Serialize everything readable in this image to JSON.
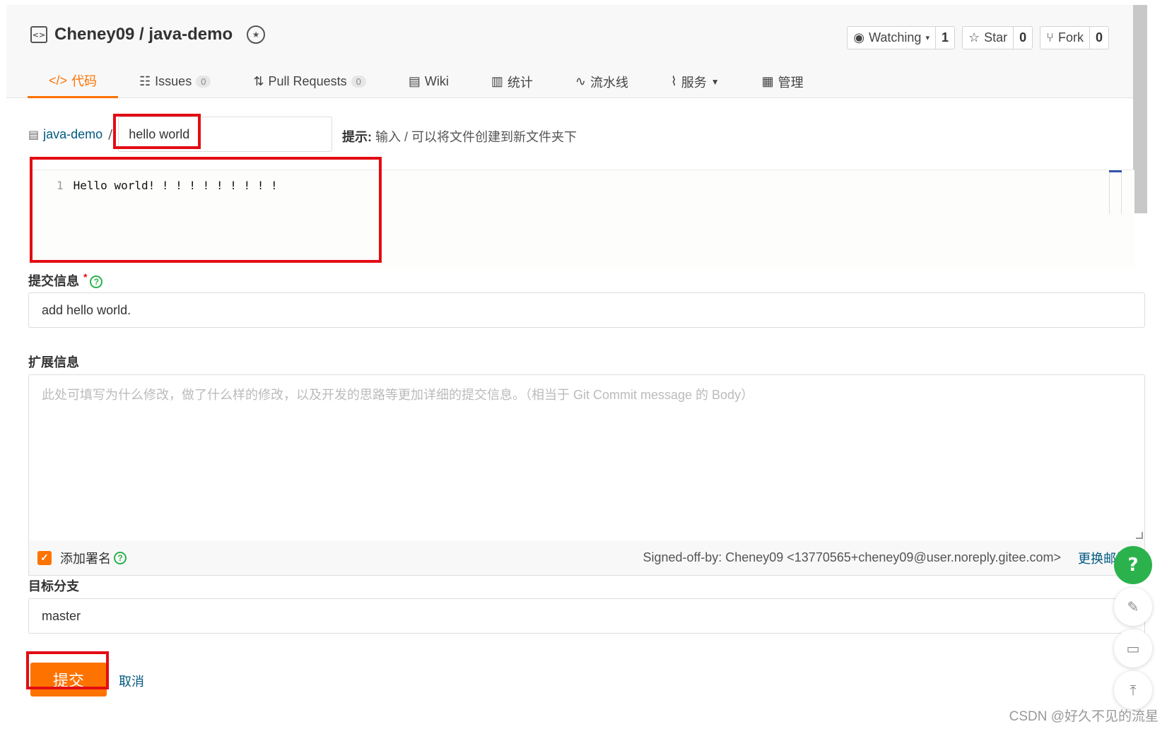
{
  "repo": {
    "title": "Cheney09 / java-demo",
    "icon": "code-repo-icon",
    "badge_icon": "gvp-badge-icon"
  },
  "actions": {
    "watch": {
      "label": "Watching",
      "icon": "eye-icon",
      "count": "1"
    },
    "star": {
      "label": "Star",
      "icon": "star-icon",
      "count": "0"
    },
    "fork": {
      "label": "Fork",
      "icon": "fork-icon",
      "count": "0"
    }
  },
  "tabs": [
    {
      "label": "代码",
      "icon": "code-icon",
      "active": true
    },
    {
      "label": "Issues",
      "icon": "issues-icon",
      "count": "0"
    },
    {
      "label": "Pull Requests",
      "icon": "pull-request-icon",
      "count": "0"
    },
    {
      "label": "Wiki",
      "icon": "wiki-icon"
    },
    {
      "label": "统计",
      "icon": "stats-icon"
    },
    {
      "label": "流水线",
      "icon": "pipeline-icon"
    },
    {
      "label": "服务",
      "icon": "service-icon"
    },
    {
      "label": "管理",
      "icon": "manage-icon"
    }
  ],
  "breadcrumb": {
    "root": "java-demo",
    "separator": "/"
  },
  "filename": {
    "value": "hello world"
  },
  "hint": {
    "label": "提示:",
    "text": "输入 / 可以将文件创建到新文件夹下"
  },
  "editor": {
    "line_number": "1",
    "line": "Hello world! ! ! ! ! ! ! ! ! !"
  },
  "commit": {
    "label": "提交信息",
    "required": "*",
    "value": "add hello world."
  },
  "extended": {
    "label": "扩展信息",
    "placeholder": "此处可填写为什么修改，做了什么样的修改，以及开发的思路等更加详细的提交信息。（相当于 Git Commit message 的 Body）"
  },
  "signoff": {
    "checkbox_label": "添加署名",
    "checked": true,
    "text": "Signed-off-by: Cheney09 <13770565+cheney09@user.noreply.gitee.com>",
    "change_email": "更换邮箱"
  },
  "branch": {
    "label": "目标分支",
    "value": "master"
  },
  "buttons": {
    "submit": "提交",
    "cancel": "取消"
  },
  "floating": {
    "help": "?"
  },
  "watermark": "CSDN @好久不见的流星",
  "colors": {
    "accent": "#fe7300",
    "link": "#005980",
    "highlight_box": "#e30c13",
    "help_green": "#2bb24c"
  }
}
